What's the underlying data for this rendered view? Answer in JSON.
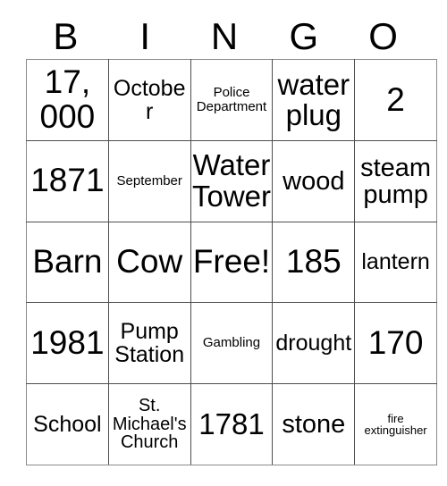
{
  "card": {
    "title_letters": [
      "B",
      "I",
      "N",
      "G",
      "O"
    ],
    "free_space_label": "Free!",
    "rows": [
      [
        {
          "text": "17, 000",
          "size": "sz-xxl"
        },
        {
          "text": "October",
          "size": "sz-m"
        },
        {
          "text": "Police Department",
          "size": "sz-xs"
        },
        {
          "text": "water plug",
          "size": "sz-xl"
        },
        {
          "text": "2",
          "size": "sz-xxl"
        }
      ],
      [
        {
          "text": "1871",
          "size": "sz-xxl"
        },
        {
          "text": "September",
          "size": "sz-xs"
        },
        {
          "text": "Water Tower",
          "size": "sz-xl"
        },
        {
          "text": "wood",
          "size": "sz-l"
        },
        {
          "text": "steam pump",
          "size": "sz-l"
        }
      ],
      [
        {
          "text": "Barn",
          "size": "sz-xxl"
        },
        {
          "text": "Cow",
          "size": "sz-xxl"
        },
        {
          "text": "Free!",
          "size": "sz-xxl"
        },
        {
          "text": "185",
          "size": "sz-xxl"
        },
        {
          "text": "lantern",
          "size": "sz-m"
        }
      ],
      [
        {
          "text": "1981",
          "size": "sz-xxl"
        },
        {
          "text": "Pump Station",
          "size": "sz-m"
        },
        {
          "text": "Gambling",
          "size": "sz-xs"
        },
        {
          "text": "drought",
          "size": "sz-m"
        },
        {
          "text": "170",
          "size": "sz-xxl"
        }
      ],
      [
        {
          "text": "School",
          "size": "sz-m"
        },
        {
          "text": "St. Michael's Church",
          "size": "sz-s"
        },
        {
          "text": "1781",
          "size": "sz-xl"
        },
        {
          "text": "stone",
          "size": "sz-l"
        },
        {
          "text": "fire extinguisher",
          "size": "sz-xxs"
        }
      ]
    ]
  }
}
